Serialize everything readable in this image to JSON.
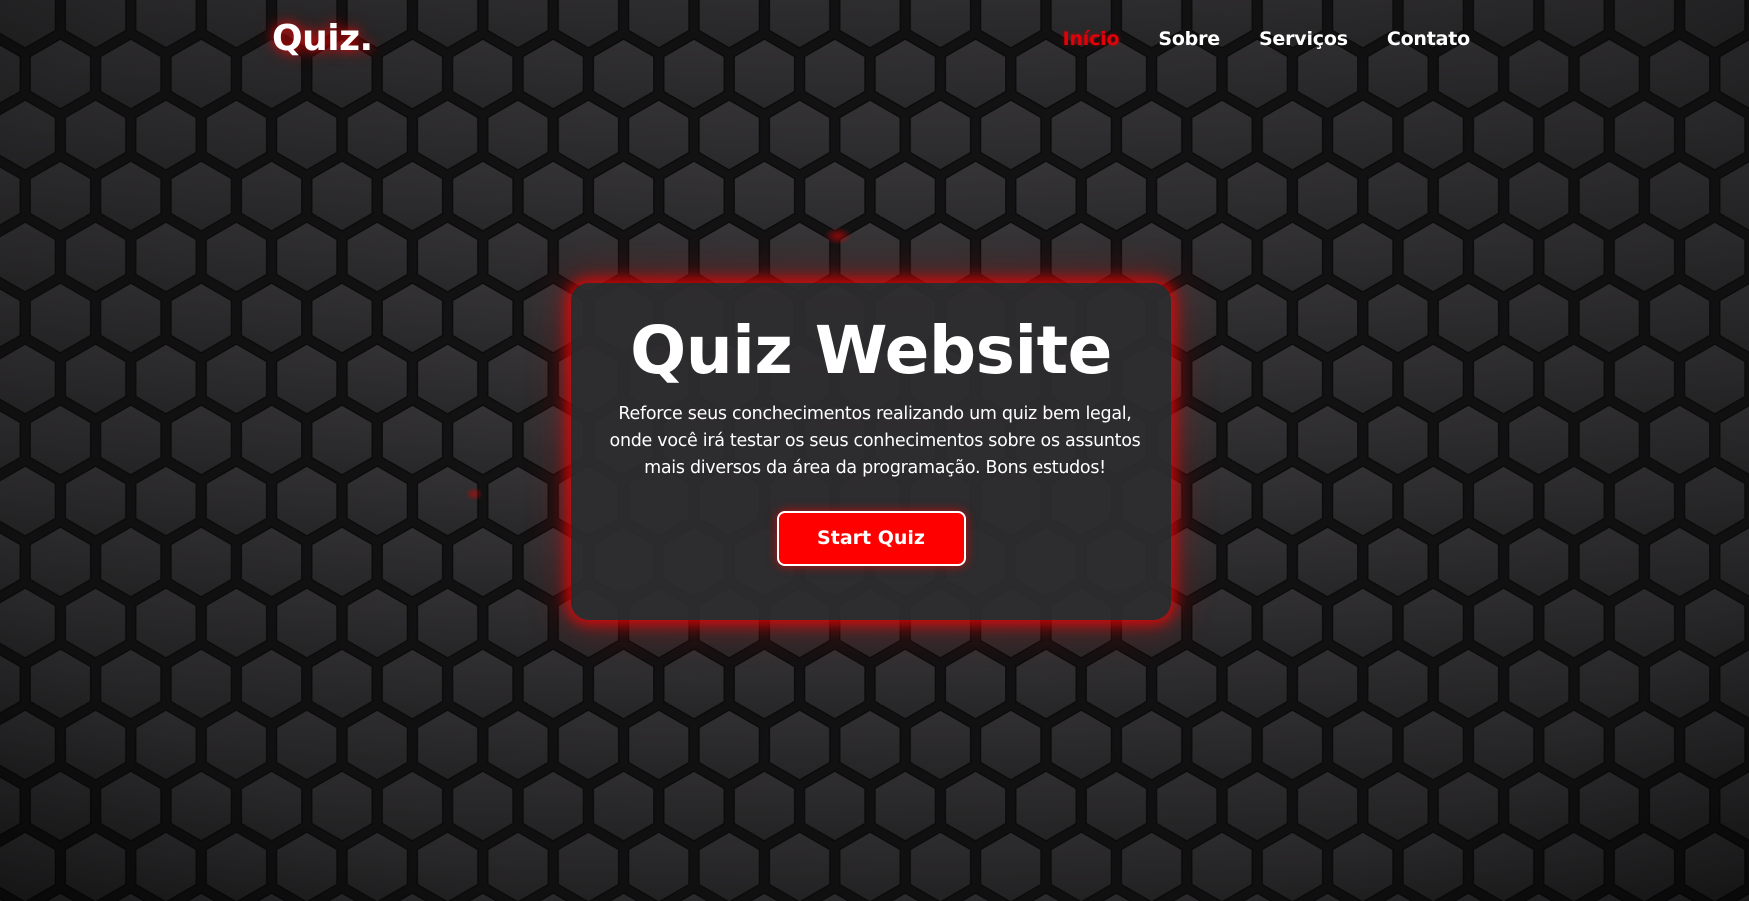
{
  "header": {
    "logo": "Quiz.",
    "nav": [
      {
        "label": "Início",
        "active": true
      },
      {
        "label": "Sobre",
        "active": false
      },
      {
        "label": "Serviços",
        "active": false
      },
      {
        "label": "Contato",
        "active": false
      }
    ]
  },
  "hero": {
    "title": "Quiz Website",
    "description": "Reforce seus conchecimentos realizando um quiz bem legal, onde você irá testar os seus conhecimentos sobre os assuntos mais diversos da área da programação. Bons estudos!",
    "button_label": "Start Quiz"
  },
  "colors": {
    "accent": "#ff0000",
    "nav_active": "#e30008",
    "background": "#1f1e1f",
    "hexagon_fill": "#363436",
    "card_background": "#2d2c2e"
  },
  "icons": {
    "background_pattern": "hexagon-pattern"
  }
}
